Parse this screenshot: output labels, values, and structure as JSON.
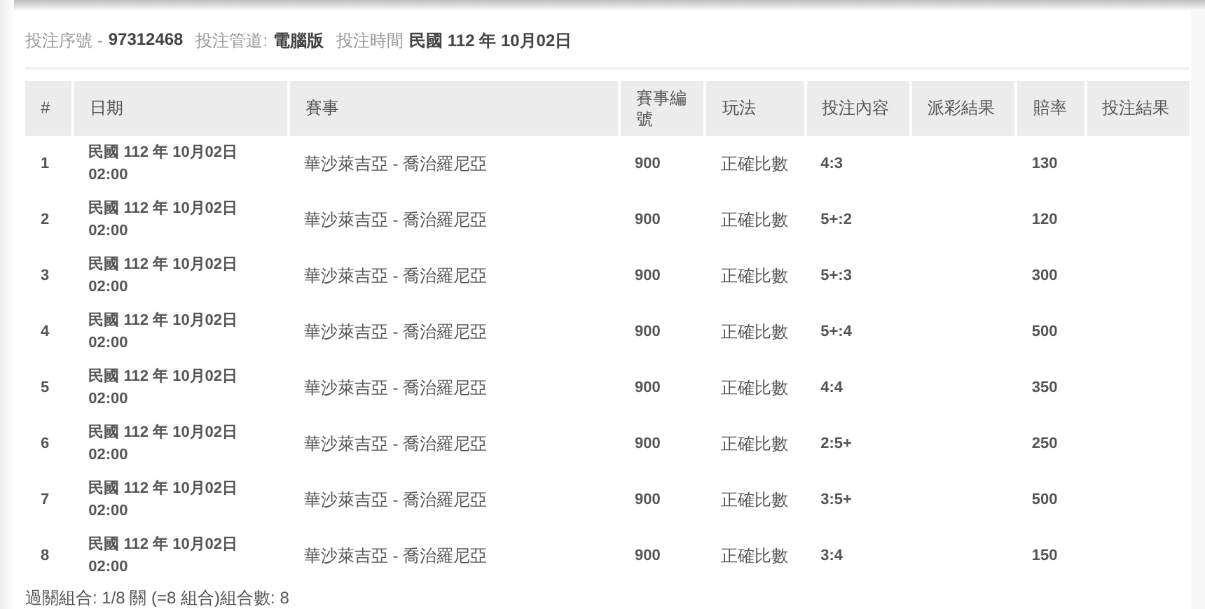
{
  "summary": [
    {
      "label": "投注序號 -",
      "value": "97312468"
    },
    {
      "label": "投注管道:",
      "value": "電腦版"
    },
    {
      "label": "投注時間",
      "value": "民國 112 年 10月02日"
    }
  ],
  "table": {
    "columns": [
      "#",
      "日期",
      "賽事",
      "賽事編號",
      "玩法",
      "投注內容",
      "派彩結果",
      "賠率",
      "投注結果"
    ],
    "rows": [
      {
        "no": "1",
        "date": "民國 112 年 10月02日",
        "time": "02:00",
        "match": "華沙萊吉亞 - 喬治羅尼亞",
        "match_no": "900",
        "play": "正確比數",
        "pick": "4:3",
        "odds": "130"
      },
      {
        "no": "2",
        "date": "民國 112 年 10月02日",
        "time": "02:00",
        "match": "華沙萊吉亞 - 喬治羅尼亞",
        "match_no": "900",
        "play": "正確比數",
        "pick": "5+:2",
        "odds": "120"
      },
      {
        "no": "3",
        "date": "民國 112 年 10月02日",
        "time": "02:00",
        "match": "華沙萊吉亞 - 喬治羅尼亞",
        "match_no": "900",
        "play": "正確比數",
        "pick": "5+:3",
        "odds": "300"
      },
      {
        "no": "4",
        "date": "民國 112 年 10月02日",
        "time": "02:00",
        "match": "華沙萊吉亞 - 喬治羅尼亞",
        "match_no": "900",
        "play": "正確比數",
        "pick": "5+:4",
        "odds": "500"
      },
      {
        "no": "5",
        "date": "民國 112 年 10月02日",
        "time": "02:00",
        "match": "華沙萊吉亞 - 喬治羅尼亞",
        "match_no": "900",
        "play": "正確比數",
        "pick": "4:4",
        "odds": "350"
      },
      {
        "no": "6",
        "date": "民國 112 年 10月02日",
        "time": "02:00",
        "match": "華沙萊吉亞 - 喬治羅尼亞",
        "match_no": "900",
        "play": "正確比數",
        "pick": "2:5+",
        "odds": "250"
      },
      {
        "no": "7",
        "date": "民國 112 年 10月02日",
        "time": "02:00",
        "match": "華沙萊吉亞 - 喬治羅尼亞",
        "match_no": "900",
        "play": "正確比數",
        "pick": "3:5+",
        "odds": "500"
      },
      {
        "no": "8",
        "date": "民國 112 年 10月02日",
        "time": "02:00",
        "match": "華沙萊吉亞 - 喬治羅尼亞",
        "match_no": "900",
        "play": "正確比數",
        "pick": "3:4",
        "odds": "150"
      }
    ]
  },
  "footer": "過關組合: 1/8 關 (=8 組合)組合數: 8"
}
